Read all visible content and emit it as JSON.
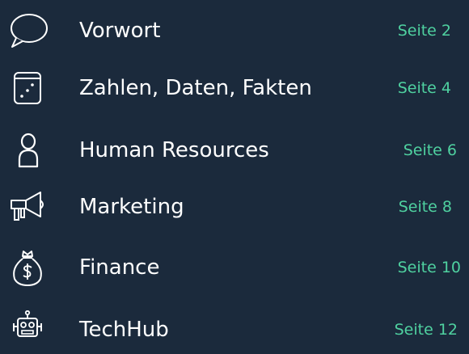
{
  "toc": {
    "items": [
      {
        "icon": "speech-bubble-icon",
        "title": "Vorwort",
        "page": "Seite 2"
      },
      {
        "icon": "dice-icon",
        "title": "Zahlen, Daten, Fakten",
        "page": "Seite 4"
      },
      {
        "icon": "person-icon",
        "title": "Human Resources",
        "page": "Seite 6"
      },
      {
        "icon": "megaphone-icon",
        "title": "Marketing",
        "page": "Seite 8"
      },
      {
        "icon": "money-bag-icon",
        "title": "Finance",
        "page": "Seite 10"
      },
      {
        "icon": "robot-icon",
        "title": "TechHub",
        "page": "Seite 12"
      }
    ]
  },
  "colors": {
    "background": "#1b2a3c",
    "title": "#ffffff",
    "page_link": "#4fd1a0",
    "icon_stroke": "#ffffff"
  }
}
